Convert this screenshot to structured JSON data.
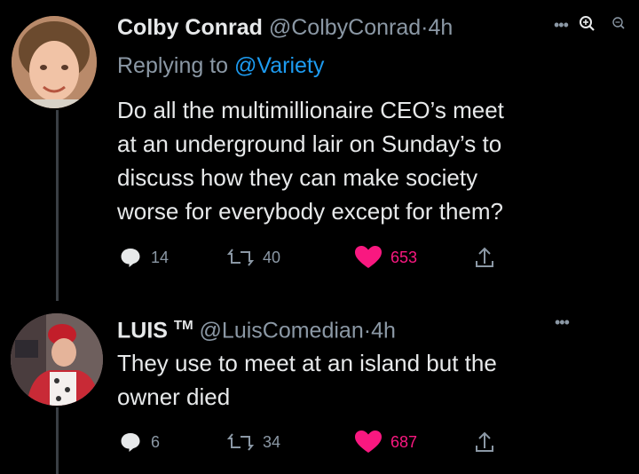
{
  "tweets": [
    {
      "author_name": "Colby Conrad",
      "author_handle": "@ColbyConrad",
      "separator": "·",
      "time": "4h",
      "replying_prefix": "Replying to ",
      "replying_handle": "@Variety",
      "text": "Do all the multimillionaire CEO’s meet\nat an underground lair on Sunday’s to\ndiscuss how they can make society\nworse for everybody except for them?",
      "replies": "14",
      "retweets": "40",
      "likes": "653",
      "liked": true
    },
    {
      "author_name": "LUIS",
      "author_badge": "TM",
      "author_handle": "@LuisComedian",
      "separator": "·",
      "time": "4h",
      "text": "They use to meet at an island but the\nowner died",
      "replies": "6",
      "retweets": "34",
      "likes": "687",
      "liked": true
    }
  ],
  "icons": {
    "reply": "reply-icon",
    "retweet": "retweet-icon",
    "like": "heart-icon",
    "share": "share-icon",
    "more": "more-icon",
    "zoom_in": "zoom-in-icon",
    "zoom_out": "zoom-out-icon"
  },
  "colors": {
    "background": "#000000",
    "text": "#e7e9ea",
    "muted": "#8b98a5",
    "link": "#1d9bf0",
    "like": "#f91880"
  }
}
